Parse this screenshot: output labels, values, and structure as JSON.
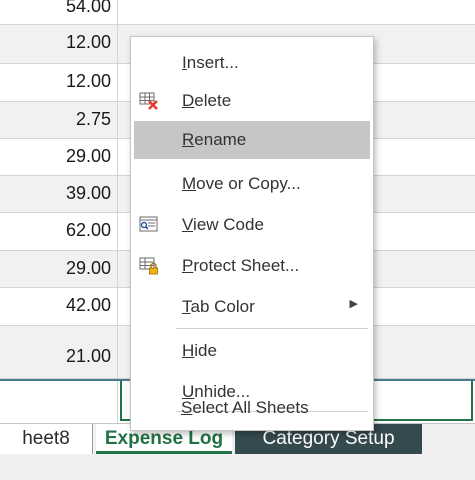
{
  "sheet": {
    "values": [
      "54.00",
      "12.00",
      "12.00",
      "2.75",
      "29.00",
      "39.00",
      "62.00",
      "29.00",
      "42.00",
      "21.00"
    ]
  },
  "tabs": {
    "sheet8": "heet8",
    "expense_log": "Expense Log",
    "category_setup": "Category Setup"
  },
  "context_menu": {
    "insert": "Insert...",
    "delete": "Delete",
    "rename": "Rename",
    "move_copy": "Move or Copy...",
    "view_code": "View Code",
    "protect_sheet": "Protect Sheet...",
    "tab_color": "Tab Color",
    "hide": "Hide",
    "unhide": "Unhide...",
    "select_all": "Select All Sheets",
    "highlighted": "Rename",
    "submenu_arrow": "▶"
  },
  "colors": {
    "accent_green": "#217346",
    "highlight": "#c6c6c6",
    "active_dark_tab": "#344a4f"
  }
}
